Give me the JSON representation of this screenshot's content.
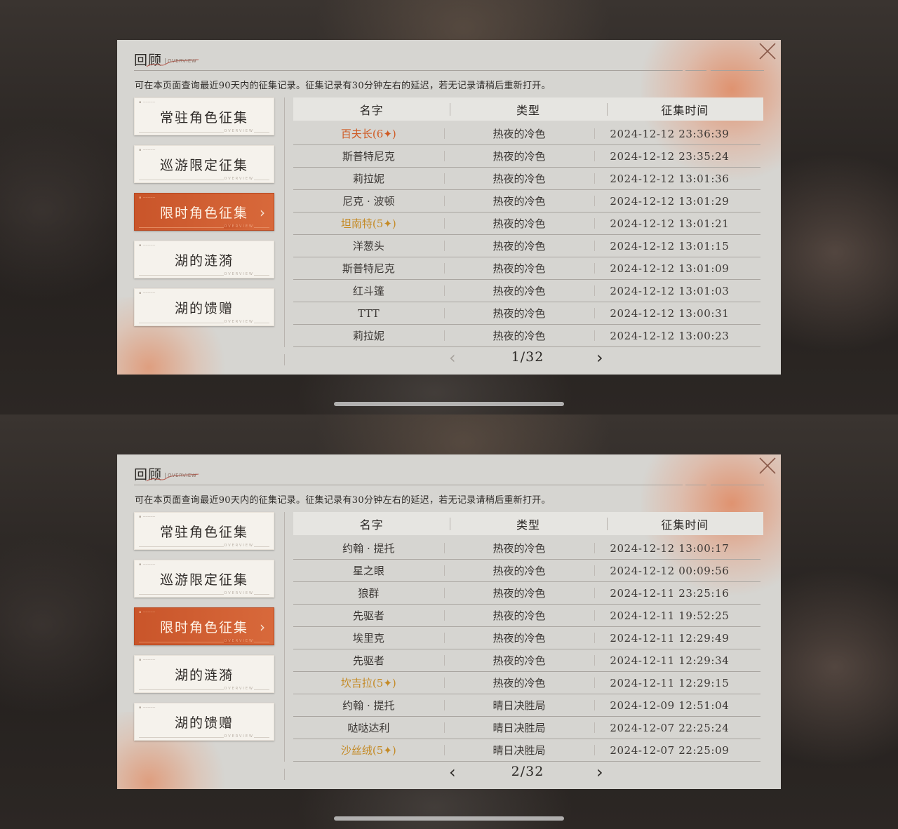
{
  "screens": [
    {
      "title": "回顾",
      "overview_tag": "OVERVIEW",
      "description": "可在本页面查询最近90天内的征集记录。征集记录有30分钟左右的延迟，若无记录请稍后重新打开。",
      "sidebar": [
        {
          "label": "常驻角色征集",
          "active": false
        },
        {
          "label": "巡游限定征集",
          "active": false
        },
        {
          "label": "限时角色征集",
          "active": true
        },
        {
          "label": "湖的涟漪",
          "active": false
        },
        {
          "label": "湖的馈赠",
          "active": false
        }
      ],
      "columns": [
        "名字",
        "类型",
        "征集时间"
      ],
      "rows": [
        {
          "name": "百夫长(6✦)",
          "type": "热夜的冷色",
          "time": "2024-12-12 23:36:39",
          "rarity": 6
        },
        {
          "name": "斯普特尼克",
          "type": "热夜的冷色",
          "time": "2024-12-12 23:35:24",
          "rarity": 0
        },
        {
          "name": "莉拉妮",
          "type": "热夜的冷色",
          "time": "2024-12-12 13:01:36",
          "rarity": 0
        },
        {
          "name": "尼克 · 波顿",
          "type": "热夜的冷色",
          "time": "2024-12-12 13:01:29",
          "rarity": 0
        },
        {
          "name": "坦南特(5✦)",
          "type": "热夜的冷色",
          "time": "2024-12-12 13:01:21",
          "rarity": 5
        },
        {
          "name": "洋葱头",
          "type": "热夜的冷色",
          "time": "2024-12-12 13:01:15",
          "rarity": 0
        },
        {
          "name": "斯普特尼克",
          "type": "热夜的冷色",
          "time": "2024-12-12 13:01:09",
          "rarity": 0
        },
        {
          "name": "红斗篷",
          "type": "热夜的冷色",
          "time": "2024-12-12 13:01:03",
          "rarity": 0
        },
        {
          "name": "TTT",
          "type": "热夜的冷色",
          "time": "2024-12-12 13:00:31",
          "rarity": 0
        },
        {
          "name": "莉拉妮",
          "type": "热夜的冷色",
          "time": "2024-12-12 13:00:23",
          "rarity": 0
        }
      ],
      "pagination": {
        "label": "1/32",
        "prev_disabled": true
      }
    },
    {
      "title": "回顾",
      "overview_tag": "OVERVIEW",
      "description": "可在本页面查询最近90天内的征集记录。征集记录有30分钟左右的延迟，若无记录请稍后重新打开。",
      "sidebar": [
        {
          "label": "常驻角色征集",
          "active": false
        },
        {
          "label": "巡游限定征集",
          "active": false
        },
        {
          "label": "限时角色征集",
          "active": true
        },
        {
          "label": "湖的涟漪",
          "active": false
        },
        {
          "label": "湖的馈赠",
          "active": false
        }
      ],
      "columns": [
        "名字",
        "类型",
        "征集时间"
      ],
      "rows": [
        {
          "name": "约翰 · 提托",
          "type": "热夜的冷色",
          "time": "2024-12-12 13:00:17",
          "rarity": 0
        },
        {
          "name": "星之眼",
          "type": "热夜的冷色",
          "time": "2024-12-12 00:09:56",
          "rarity": 0
        },
        {
          "name": "狼群",
          "type": "热夜的冷色",
          "time": "2024-12-11 23:25:16",
          "rarity": 0
        },
        {
          "name": "先驱者",
          "type": "热夜的冷色",
          "time": "2024-12-11 19:52:25",
          "rarity": 0
        },
        {
          "name": "埃里克",
          "type": "热夜的冷色",
          "time": "2024-12-11 12:29:49",
          "rarity": 0
        },
        {
          "name": "先驱者",
          "type": "热夜的冷色",
          "time": "2024-12-11 12:29:34",
          "rarity": 0
        },
        {
          "name": "坎吉拉(5✦)",
          "type": "热夜的冷色",
          "time": "2024-12-11 12:29:15",
          "rarity": 5
        },
        {
          "name": "约翰 · 提托",
          "type": "晴日决胜局",
          "time": "2024-12-09 12:51:04",
          "rarity": 0
        },
        {
          "name": "哒哒达利",
          "type": "晴日决胜局",
          "time": "2024-12-07 22:25:24",
          "rarity": 0
        },
        {
          "name": "沙丝绒(5✦)",
          "type": "晴日决胜局",
          "time": "2024-12-07 22:25:09",
          "rarity": 5
        }
      ],
      "pagination": {
        "label": "2/32",
        "prev_disabled": false
      }
    }
  ],
  "icons": {
    "close": "close-icon",
    "prev": "chevron-left-icon",
    "next": "chevron-right-icon"
  },
  "colors": {
    "accent": "#d25f30",
    "rarity6": "#cf5a23",
    "rarity5": "#c48a25"
  }
}
